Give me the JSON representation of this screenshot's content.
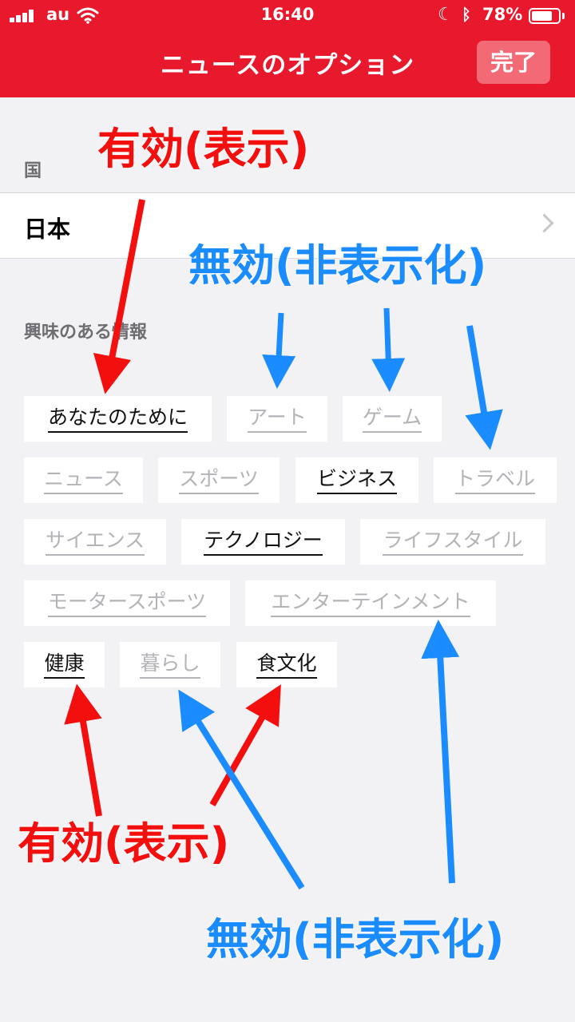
{
  "status_bar": {
    "carrier": "au",
    "time": "16:40",
    "battery": "78%",
    "battery_level": 0.78,
    "icons": [
      "signal-icon",
      "wifi-icon",
      "moon-icon",
      "bluetooth-icon",
      "battery-icon"
    ]
  },
  "nav": {
    "title": "ニュースのオプション",
    "done_label": "完了"
  },
  "country_section": {
    "label": "国",
    "value": "日本"
  },
  "interests_section": {
    "label": "興味のある情報",
    "topics": [
      {
        "label": "あなたのために",
        "enabled": true
      },
      {
        "label": "アート",
        "enabled": false
      },
      {
        "label": "ゲーム",
        "enabled": false
      },
      {
        "label": "ニュース",
        "enabled": false
      },
      {
        "label": "スポーツ",
        "enabled": false
      },
      {
        "label": "ビジネス",
        "enabled": true
      },
      {
        "label": "トラベル",
        "enabled": false
      },
      {
        "label": "サイエンス",
        "enabled": false
      },
      {
        "label": "テクノロジー",
        "enabled": true
      },
      {
        "label": "ライフスタイル",
        "enabled": false
      },
      {
        "label": "モータースポーツ",
        "enabled": false
      },
      {
        "label": "エンターテインメント",
        "enabled": false
      },
      {
        "label": "健康",
        "enabled": true
      },
      {
        "label": "暮らし",
        "enabled": false
      },
      {
        "label": "食文化",
        "enabled": true
      }
    ]
  },
  "annotations": {
    "enabled_label": "有効(表示)",
    "disabled_label": "無効(非表示化)",
    "colors": {
      "enabled": "#f40f0f",
      "disabled": "#1a8cff",
      "header": "#e8192c"
    }
  }
}
